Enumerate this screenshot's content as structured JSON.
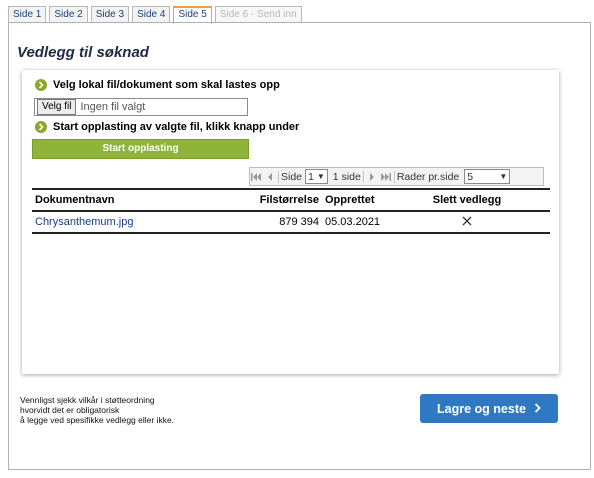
{
  "tabs": [
    {
      "label": "Side 1",
      "state": "normal"
    },
    {
      "label": "Side 2",
      "state": "normal"
    },
    {
      "label": "Side 3",
      "state": "normal"
    },
    {
      "label": "Side 4",
      "state": "normal"
    },
    {
      "label": "Side 5",
      "state": "active"
    },
    {
      "label": "Side 6 - Send inn",
      "state": "disabled"
    }
  ],
  "page_title": "Vedlegg til søknad",
  "steps": {
    "select_file": "Velg lokal fil/dokument som skal lastes opp",
    "start_upload": "Start opplasting av valgte fil, klikk knapp under"
  },
  "file_input": {
    "button_label": "Velg fil",
    "status": "Ingen fil valgt"
  },
  "upload_button": "Start opplasting",
  "pager": {
    "page_label": "Side",
    "page_value": "1",
    "page_count": "1 side",
    "rows_label": "Rader pr.side",
    "rows_value": "5"
  },
  "table": {
    "headers": [
      "Dokumentnavn",
      "Filstørrelse",
      "Opprettet",
      "Slett vedlegg"
    ],
    "rows": [
      {
        "name": "Chrysanthemum.jpg",
        "size": "879 394",
        "created": "05.03.2021"
      }
    ]
  },
  "note": [
    "Vennligst sjekk vilkår i støtteordning",
    "hvorvidt det er obligatorisk",
    "å legge ved spesifikke vedlegg eller ikke."
  ],
  "next_button": "Lagre og neste",
  "icons": {
    "step": "arrow-right-circle-icon",
    "delete": "close-icon",
    "next": "chevron-right-icon"
  },
  "colors": {
    "accent_green": "#8fb43a",
    "primary_blue": "#2f78c4",
    "active_tab_border": "#e8a33d"
  }
}
